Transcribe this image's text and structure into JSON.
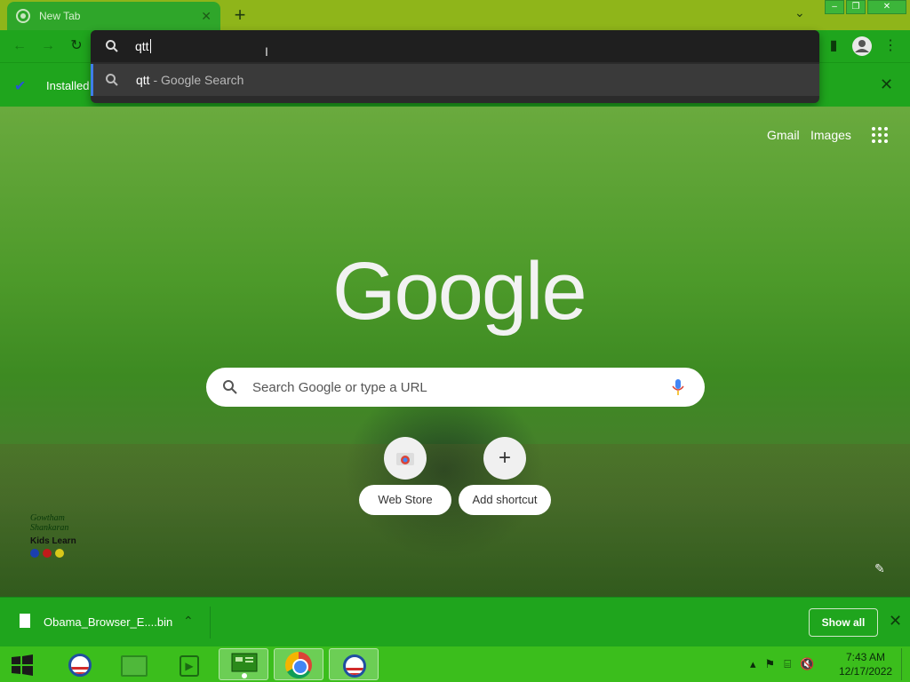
{
  "browser": {
    "tab": {
      "title": "New Tab",
      "close_glyph": "✕"
    },
    "new_tab_glyph": "+",
    "tab_search_glyph": "⌄",
    "window_controls": {
      "minimize": "–",
      "maximize": "❐",
      "close": "✕"
    }
  },
  "toolbar": {
    "back_glyph": "←",
    "forward_glyph": "→",
    "reload_glyph": "↻",
    "side_panel_glyph": "▮",
    "menu_glyph": "⋮"
  },
  "infobar": {
    "check_glyph": "✔",
    "label": "Installed",
    "close_glyph": "✕"
  },
  "omnibox": {
    "query": "qtt",
    "suggestion_query": "qtt",
    "suggestion_suffix": " - Google Search"
  },
  "ntp": {
    "gmail": "Gmail",
    "images": "Images",
    "logo": "Google",
    "search_placeholder": "Search Google or type a URL",
    "shortcuts": [
      {
        "label": "Web Store"
      },
      {
        "label": "Add shortcut",
        "glyph": "+"
      }
    ],
    "edit_glyph": "✎"
  },
  "watermark": {
    "line1": "Gowtham",
    "line2": "Shankaran",
    "kids": "Kids Learn",
    "colors": [
      "#1a3fb0",
      "#c01a1a",
      "#d8c81a"
    ]
  },
  "downloads": {
    "file_name": "Obama_Browser_E....bin",
    "chevron": "⌃",
    "show_all": "Show all",
    "close_glyph": "✕"
  },
  "taskbar": {
    "time": "7:43 AM",
    "date": "12/17/2022",
    "tray": {
      "arrow": "▴",
      "flag": "⚑",
      "network": "⌸",
      "volume": "🔇"
    }
  },
  "colors": {
    "tabstrip": "#8fb51a",
    "toolbar": "#1fa51d",
    "taskbar": "#3bbe1c",
    "omnibox_accent": "#3f7ee8"
  }
}
